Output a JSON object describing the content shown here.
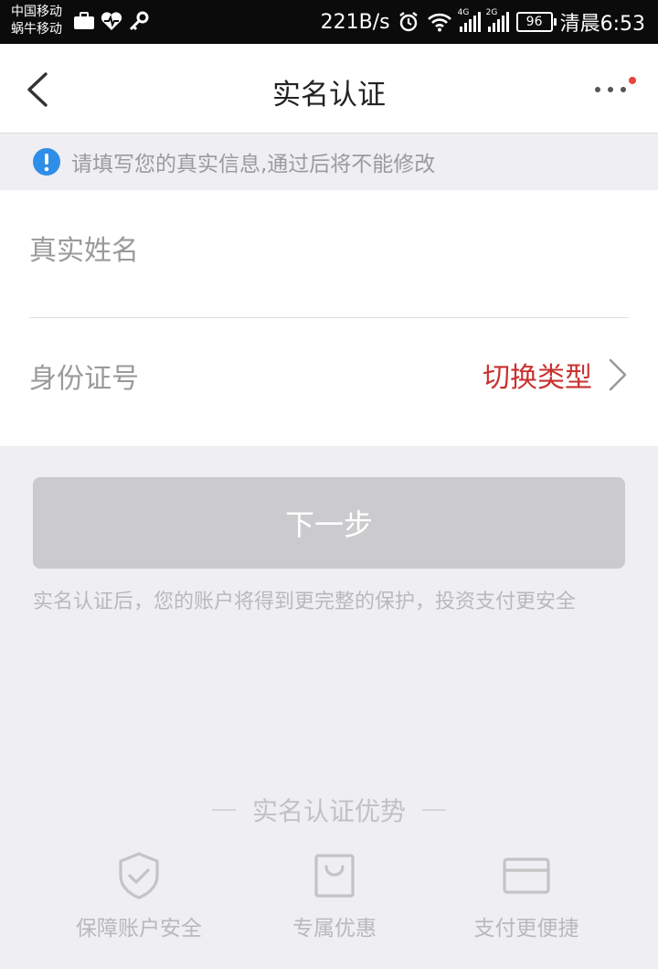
{
  "status_bar": {
    "carrier_1": "中国移动",
    "carrier_2": "蜗牛移动",
    "net_speed": "221B/s",
    "net_4g": "4G",
    "net_2g": "2G",
    "battery": "96",
    "clock": "清晨6:53"
  },
  "header": {
    "title": "实名认证"
  },
  "notice": {
    "text": "请填写您的真实信息,通过后将不能修改"
  },
  "form": {
    "name_placeholder": "真实姓名",
    "id_placeholder": "身份证号",
    "switch_type": "切换类型"
  },
  "next_button": "下一步",
  "hint": "实名认证后，您的账户将得到更完整的保护，投资支付更安全",
  "advantages": {
    "title": "实名认证优势",
    "items": [
      {
        "label": "保障账户安全",
        "icon": "shield-check-icon"
      },
      {
        "label": "专属优惠",
        "icon": "shopping-bag-icon"
      },
      {
        "label": "支付更便捷",
        "icon": "card-icon"
      }
    ]
  },
  "colors": {
    "accent_red": "#c8322f",
    "info_blue": "#2f8ee8",
    "disabled_button": "#cbcacd",
    "page_background": "#efeef3"
  }
}
